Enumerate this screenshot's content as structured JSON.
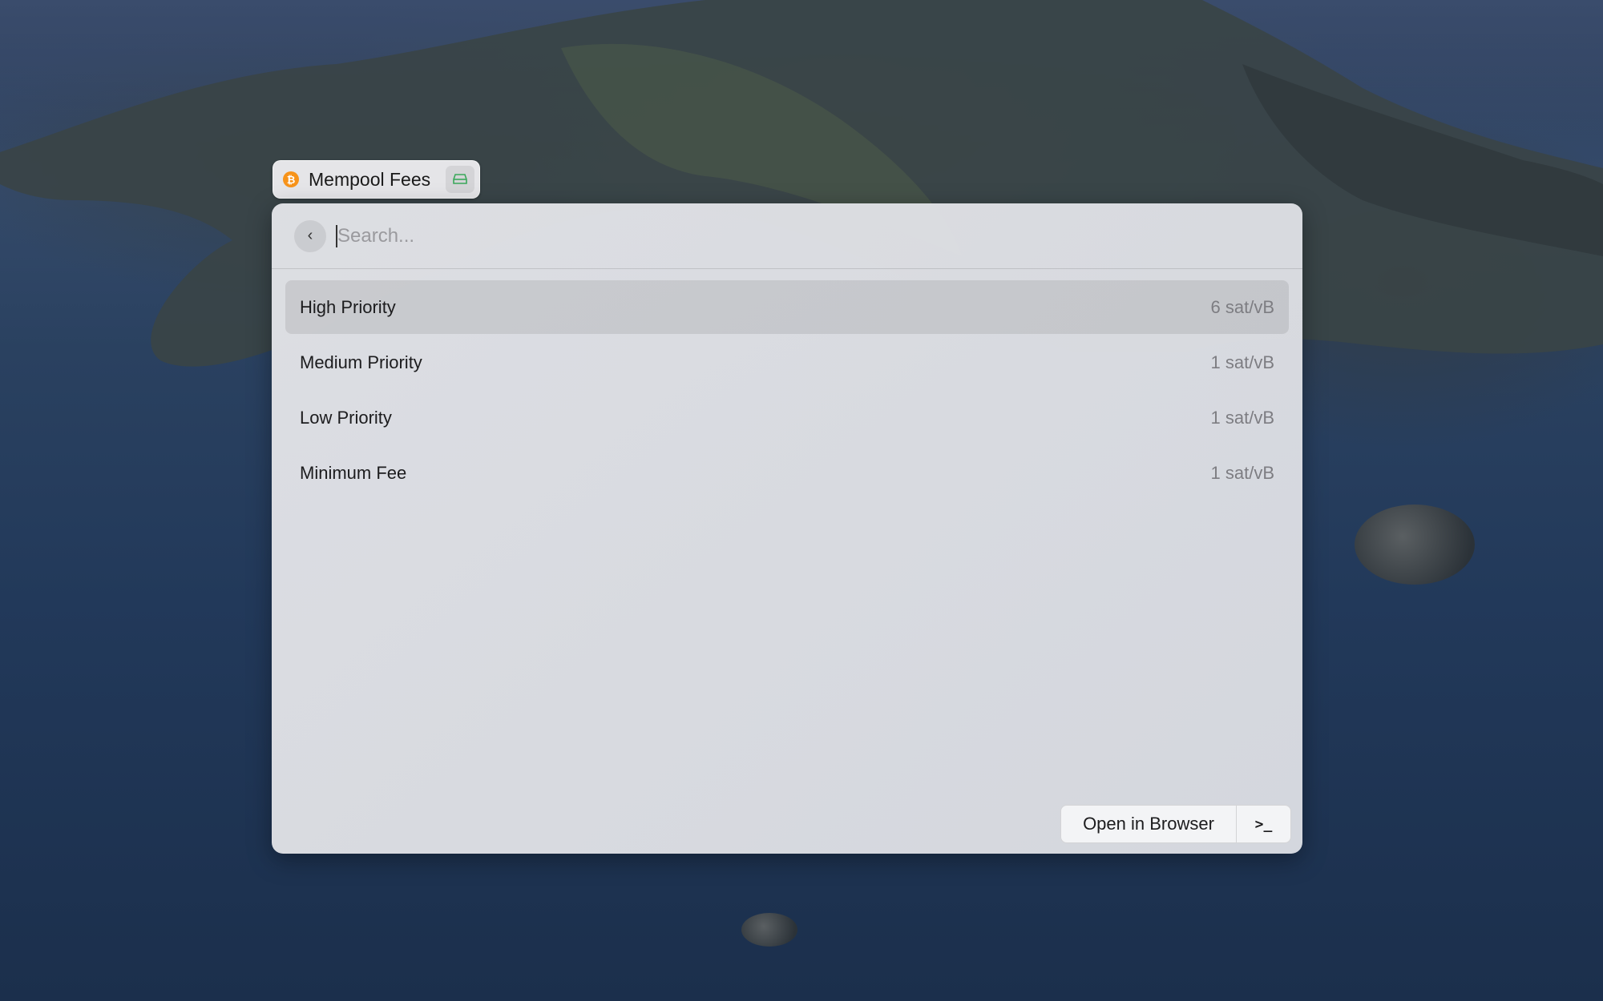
{
  "window": {
    "title": "Mempool Fees",
    "icon": "bitcoin-icon",
    "accessory_icon": "drive-icon"
  },
  "search": {
    "placeholder": "Search...",
    "value": ""
  },
  "items": [
    {
      "title": "High Priority",
      "value": "6 sat/vB",
      "selected": true
    },
    {
      "title": "Medium Priority",
      "value": "1 sat/vB",
      "selected": false
    },
    {
      "title": "Low Priority",
      "value": "1 sat/vB",
      "selected": false
    },
    {
      "title": "Minimum Fee",
      "value": "1 sat/vB",
      "selected": false
    }
  ],
  "actions": {
    "primary_label": "Open in Browser",
    "secondary_icon": "terminal-icon"
  },
  "colors": {
    "bitcoin": "#f7931a",
    "drive_icon": "#3aa85a"
  }
}
